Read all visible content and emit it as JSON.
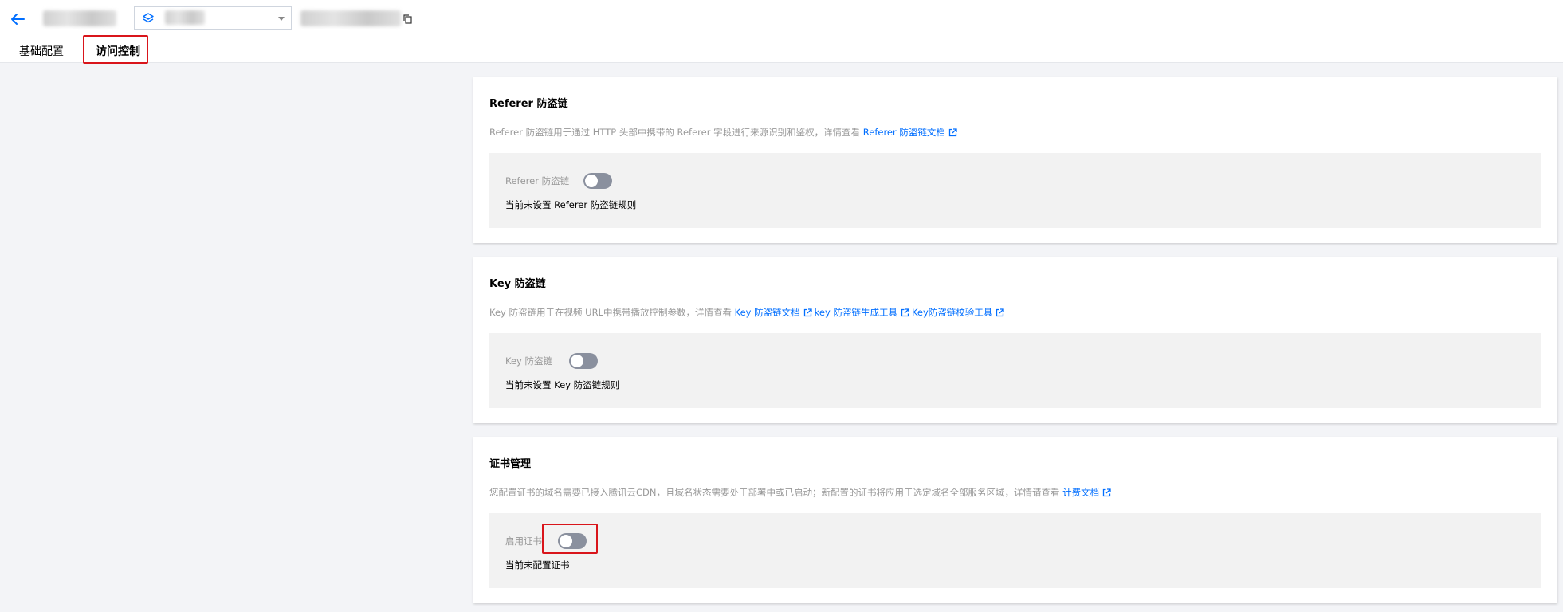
{
  "tabs": [
    {
      "label": "基础配置",
      "active": false
    },
    {
      "label": "访问控制",
      "active": true
    }
  ],
  "colors": {
    "link": "#006eff",
    "highlight": "#d9151b",
    "toggle_off": "#8a909e"
  },
  "sections": {
    "referer": {
      "title": "Referer 防盗链",
      "desc": "Referer 防盗链用于通过 HTTP 头部中携带的 Referer 字段进行来源识别和鉴权，详情查看",
      "link1": "Referer 防盗链文档",
      "field_label": "Referer 防盗链",
      "toggle_on": false,
      "status": "当前未设置 Referer 防盗链规则"
    },
    "key": {
      "title": "Key 防盗链",
      "desc": "Key 防盗链用于在视频 URL中携带播放控制参数，详情查看",
      "link1": "Key 防盗链文档",
      "link2": "key 防盗链生成工具",
      "link3": "Key防盗链校验工具",
      "field_label": "Key 防盗链",
      "toggle_on": false,
      "status": "当前未设置 Key 防盗链规则"
    },
    "cert": {
      "title": "证书管理",
      "desc": "您配置证书的域名需要已接入腾讯云CDN，且域名状态需要处于部署中或已启动；新配置的证书将应用于选定域名全部服务区域，详情请查看",
      "link1": "计费文档",
      "field_label": "启用证书",
      "toggle_on": false,
      "status": "当前未配置证书"
    }
  }
}
